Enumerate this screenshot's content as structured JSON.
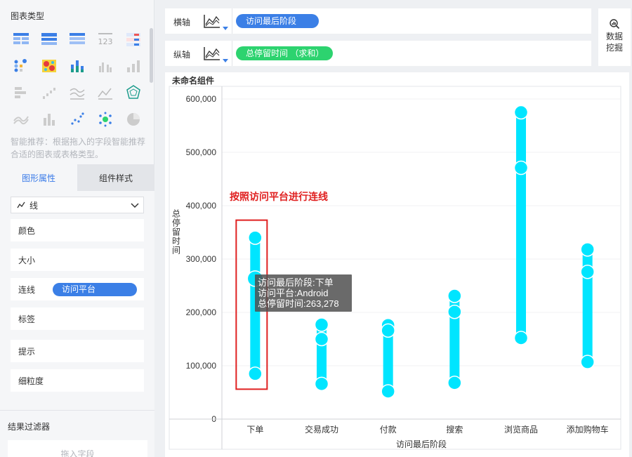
{
  "left_panel": {
    "chart_type_title": "图表类型",
    "smart_tip": "智能推荐：根据拖入的字段智能推荐合适的图表或表格类型。",
    "tabs": {
      "shape": "图形属性",
      "style": "组件样式"
    },
    "mark_select": {
      "icon": "line-chart-icon",
      "value": "线"
    },
    "props": {
      "color": "颜色",
      "size": "大小",
      "connect": "连线",
      "connect_field": "访问平台",
      "label": "标签",
      "tooltip": "提示",
      "granularity": "细粒度"
    },
    "filter": {
      "title": "结果过滤器",
      "placeholder": "拖入字段"
    }
  },
  "shelves": {
    "x": {
      "label": "横轴",
      "field": "访问最后阶段"
    },
    "y": {
      "label": "纵轴",
      "field": "总停留时间 （求和）"
    }
  },
  "mining_button": {
    "label": "数据挖掘",
    "icon": "data-mining-icon"
  },
  "widget_title": "未命名组件",
  "colors": {
    "accent": "#3b7fe6",
    "green_pill": "#2dd36f",
    "series": "#00e5ff",
    "annotation": "#e02020"
  },
  "chart_data": {
    "type": "line",
    "categories": [
      "下单",
      "交易成功",
      "付款",
      "搜索",
      "浏览商品",
      "添加购物车"
    ],
    "xlabel": "访问最后阶段",
    "ylabel": "总停留时间",
    "ylim": [
      0,
      600000
    ],
    "yticks": [
      0,
      100000,
      200000,
      300000,
      400000,
      500000,
      600000
    ],
    "ytick_labels": [
      "0",
      "100,000",
      "200,000",
      "300,000",
      "400,000",
      "500,000",
      "600,000"
    ],
    "grid": true,
    "points": [
      [
        340000,
        263278,
        85000
      ],
      [
        177000,
        150000,
        66000
      ],
      [
        176000,
        166000,
        52000
      ],
      [
        231000,
        201000,
        68000
      ],
      [
        575000,
        471000,
        152000
      ],
      [
        318000,
        276000,
        107000
      ]
    ],
    "annotation": "按照访问平台进行连线",
    "tooltip": {
      "lines": [
        "访问最后阶段:下单",
        "访问平台:Android",
        "总停留时间:263,278"
      ]
    }
  }
}
